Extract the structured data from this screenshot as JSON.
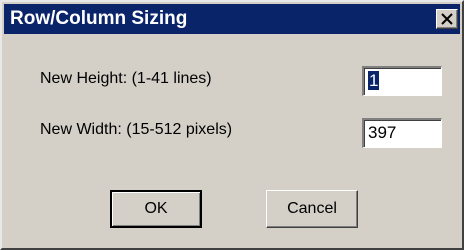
{
  "window": {
    "title": "Row/Column Sizing",
    "close_icon": "close-icon"
  },
  "height": {
    "label": "New Height: (1-41 lines)",
    "value": "1"
  },
  "width": {
    "label": "New Width: (15-512 pixels)",
    "value": "397"
  },
  "buttons": {
    "ok": "OK",
    "cancel": "Cancel"
  }
}
